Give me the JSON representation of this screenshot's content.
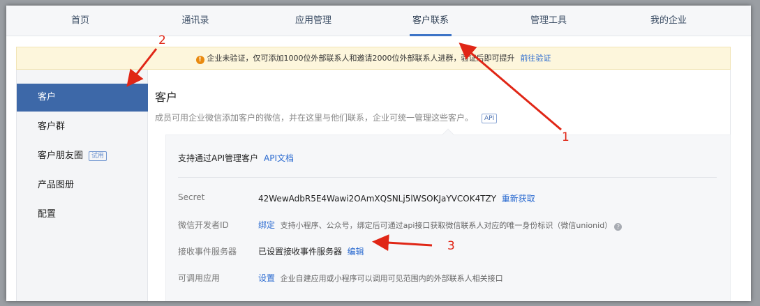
{
  "nav": {
    "items": [
      "首页",
      "通讯录",
      "应用管理",
      "客户联系",
      "管理工具",
      "我的企业"
    ],
    "active_index": 3
  },
  "notice": {
    "icon": "warning-icon",
    "text": "企业未验证，仅可添加1000位外部联系人和邀请2000位外部联系人进群，验证后即可提升",
    "link": "前往验证"
  },
  "sidebar": {
    "items": [
      {
        "label": "客户",
        "active": true
      },
      {
        "label": "客户群"
      },
      {
        "label": "客户朋友圈",
        "badge": "试用"
      },
      {
        "label": "产品图册"
      },
      {
        "label": "配置"
      }
    ]
  },
  "content": {
    "title": "客户",
    "desc": "成员可用企业微信添加客户的微信，并在这里与他们联系，企业可统一管理这些客户。",
    "api_tag": "API"
  },
  "panel": {
    "head": "支持通过API管理客户",
    "head_link": "API文档",
    "rows": [
      {
        "label": "Secret",
        "value": "42WewAdbR5E4Wawi2OAmXQSNLj5lWSOKJaYVCOK4TZY",
        "link": "重新获取"
      },
      {
        "label": "微信开发者ID",
        "link": "绑定",
        "hint": "支持小程序、公众号，绑定后可通过api接口获取微信联系人对应的唯一身份标识（微信unionid）"
      },
      {
        "label": "接收事件服务器",
        "value": "已设置接收事件服务器",
        "link": "编辑"
      },
      {
        "label": "可调用应用",
        "link": "设置",
        "hint": "企业自建应用或小程序可以调用可见范围内的外部联系人相关接口"
      }
    ]
  },
  "annotations": {
    "one": "1",
    "two": "2",
    "three": "3"
  },
  "colors": {
    "accent": "#3d68a8",
    "link": "#2a6ad0",
    "annotation": "#e02616",
    "notice_bg": "#fdf6dc"
  }
}
